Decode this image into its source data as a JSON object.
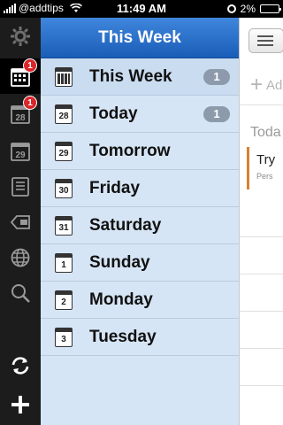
{
  "status_bar": {
    "carrier": "@addtips",
    "time": "11:49 AM",
    "battery": "2%"
  },
  "rail": {
    "items": [
      {
        "name": "settings-gear-icon"
      },
      {
        "name": "week-calendar-icon",
        "badge": "1"
      },
      {
        "name": "today-calendar-icon",
        "day": "28",
        "badge": "1"
      },
      {
        "name": "tomorrow-calendar-icon",
        "day": "29"
      },
      {
        "name": "list-icon"
      },
      {
        "name": "tag-icon"
      },
      {
        "name": "globe-icon"
      },
      {
        "name": "search-icon"
      },
      {
        "name": "sync-icon"
      },
      {
        "name": "add-icon"
      }
    ]
  },
  "panel": {
    "title": "This Week",
    "rows": [
      {
        "label": "This Week",
        "icon": "grid",
        "count": "1"
      },
      {
        "label": "Today",
        "day": "28",
        "count": "1"
      },
      {
        "label": "Tomorrow",
        "day": "29"
      },
      {
        "label": "Friday",
        "day": "30"
      },
      {
        "label": "Saturday",
        "day": "31"
      },
      {
        "label": "Sunday",
        "day": "1"
      },
      {
        "label": "Monday",
        "day": "2"
      },
      {
        "label": "Tuesday",
        "day": "3"
      }
    ]
  },
  "content": {
    "add_placeholder": "Ad",
    "section_title": "Toda",
    "task_title": "Try",
    "task_subtitle": "Pers",
    "accent_color": "#d9802f"
  }
}
